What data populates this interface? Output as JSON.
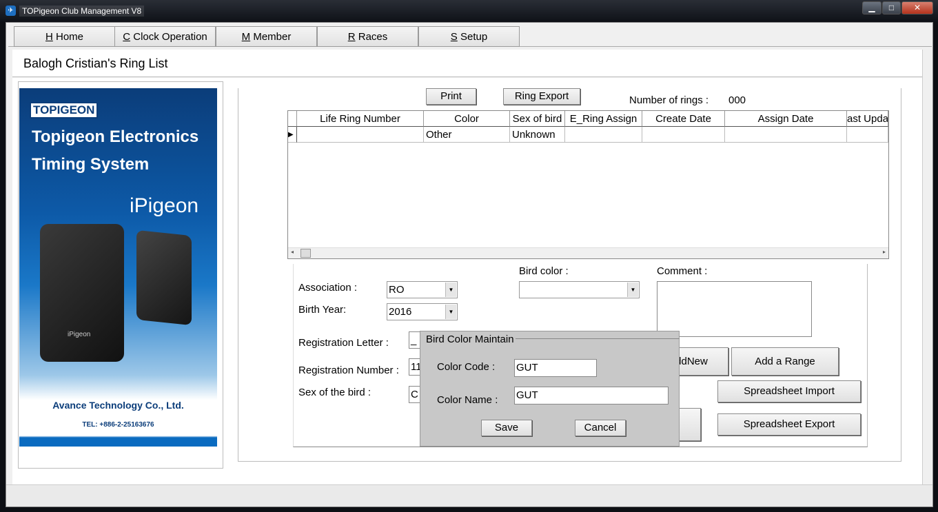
{
  "window": {
    "title": "TOPigeon Club Management V8",
    "controls": {
      "minimize": "▁",
      "maximize": "□",
      "close": "✕"
    }
  },
  "tabs": [
    {
      "key": "H",
      "label": " Home"
    },
    {
      "key": "C",
      "label": " Clock Operation"
    },
    {
      "key": "M",
      "label": " Member"
    },
    {
      "key": "R",
      "label": " Races"
    },
    {
      "key": "S",
      "label": " Setup"
    }
  ],
  "header": {
    "title": "Balogh Cristian's Ring List"
  },
  "banner": {
    "logo": "TOPIGEON",
    "headline1": "Topigeon Electronics",
    "headline2": "Timing System",
    "product": "iPigeon",
    "device_label": "iPigeon",
    "company": "Avance Technology Co., Ltd.",
    "tel": "TEL: +886-2-25163676"
  },
  "toolbar": {
    "print": "Print",
    "ring_export": "Ring Export",
    "count_label": "Number of rings :",
    "count_value": "000"
  },
  "grid": {
    "columns": [
      "Life Ring Number",
      "Color",
      "Sex of bird",
      "E_Ring Assign",
      "Create Date",
      "Assign Date",
      "ast Upda"
    ],
    "rows": [
      [
        "",
        "Other",
        "Unknown",
        "",
        "",
        "",
        ""
      ]
    ]
  },
  "form": {
    "association_label": "Association :",
    "association_value": "RO",
    "birth_year_label": "Birth Year:",
    "birth_year_value": "2016",
    "bird_color_label": "Bird color :",
    "bird_color_value": "",
    "comment_label": "Comment :",
    "comment_value": "",
    "reg_letter_label": "Registration Letter :",
    "reg_letter_value": "_",
    "reg_number_label": "Registration Number :",
    "reg_number_value": "11",
    "sex_label": "Sex of the bird :",
    "sex_value": "C",
    "addnew": "AddNew",
    "add_range": "Add a Range",
    "sheet_import": "Spreadsheet Import",
    "sheet_export": "Spreadsheet Export"
  },
  "dialog": {
    "title": "Bird Color Maintain",
    "code_label": "Color Code :",
    "code_value": "GUT",
    "name_label": "Color Name :",
    "name_value": "GUT",
    "save": "Save",
    "cancel": "Cancel"
  }
}
